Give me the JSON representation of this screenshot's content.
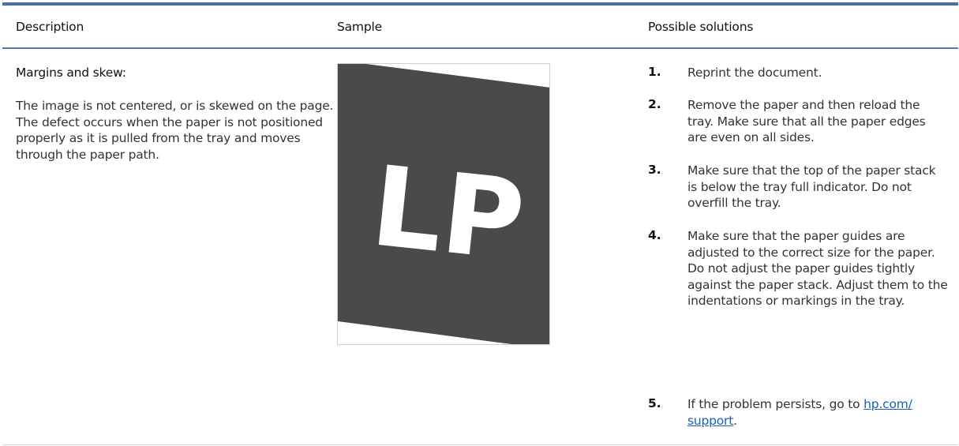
{
  "table": {
    "headers": {
      "description": "Description",
      "sample": "Sample",
      "solutions": "Possible solutions"
    },
    "row": {
      "title": "Margins and skew:",
      "description": "The image is not centered, or is skewed on the page. The defect occurs when the paper is not positioned properly as it is pulled from the tray and moves through the paper path.",
      "sample_letters": "LP",
      "steps": [
        {
          "num": "1.",
          "text": "Reprint the document."
        },
        {
          "num": "2.",
          "text": "Remove the paper and then reload the tray. Make sure that all the paper edges are even on all sides."
        },
        {
          "num": "3.",
          "text": "Make sure that the top of the paper stack is below the tray full indicator. Do not overfill the tray."
        },
        {
          "num": "4.",
          "text": "Make sure that the paper guides are adjusted to the correct size for the paper. Do not adjust the paper guides tightly against the paper stack. Adjust them to the indentations or markings in the tray."
        },
        {
          "num": "5.",
          "text_before": "If the problem persists, go to ",
          "link_line1": "hp.com/",
          "link_line2": "support",
          "text_after": "."
        }
      ]
    }
  },
  "colors": {
    "rule": "#4b6ea8",
    "sample_fill": "#4a4a4c",
    "link": "#1a5fb4"
  }
}
